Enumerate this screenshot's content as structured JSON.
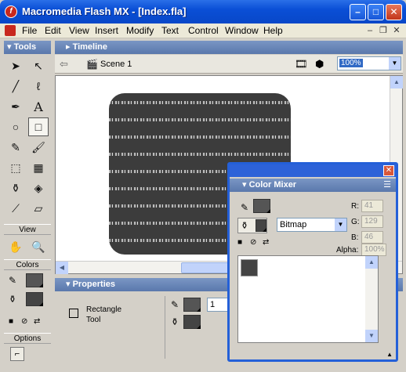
{
  "window": {
    "title": "Macromedia Flash MX - [Index.fla]"
  },
  "menu": [
    "File",
    "Edit",
    "View",
    "Insert",
    "Modify",
    "Text",
    "Control",
    "Window",
    "Help"
  ],
  "tools_panel": {
    "title": "Tools",
    "view_label": "View",
    "colors_label": "Colors",
    "options_label": "Options"
  },
  "timeline": {
    "title": "Timeline",
    "scene_label": "Scene 1",
    "zoom": "100%"
  },
  "properties": {
    "title": "Properties",
    "tool_name": "Rectangle Tool",
    "stroke_height": "1"
  },
  "color_mixer": {
    "title": "Color Mixer",
    "fill_type": "Bitmap",
    "r_label": "R:",
    "r_value": "41",
    "g_label": "G:",
    "g_value": "129",
    "b_label": "B:",
    "b_value": "46",
    "alpha_label": "Alpha:",
    "alpha_value": "100%"
  },
  "colors": {
    "titlebar": "#0a4fd6",
    "panel_header": "#6a86b8",
    "stage": "#ffffff",
    "artboard": "#3c3c3c"
  }
}
